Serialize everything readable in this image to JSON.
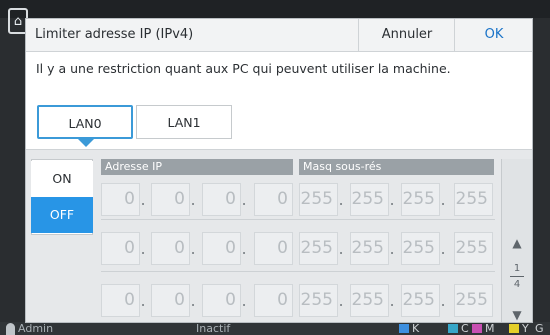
{
  "dialog": {
    "title": "Limiter adresse IP (IPv4)",
    "cancel_label": "Annuler",
    "ok_label": "OK",
    "message": "Il y a une restriction quant aux PC qui peuvent utiliser la machine."
  },
  "tabs": [
    {
      "label": "LAN0",
      "selected": true
    },
    {
      "label": "LAN1",
      "selected": false
    }
  ],
  "toggle": {
    "on_label": "ON",
    "off_label": "OFF",
    "selected": "OFF"
  },
  "columns": {
    "ip": "Adresse IP",
    "mask": "Masq sous-rés"
  },
  "rows": [
    {
      "ip": [
        "0",
        "0",
        "0",
        "0"
      ],
      "mask": [
        "255",
        "255",
        "255",
        "255"
      ]
    },
    {
      "ip": [
        "0",
        "0",
        "0",
        "0"
      ],
      "mask": [
        "255",
        "255",
        "255",
        "255"
      ]
    },
    {
      "ip": [
        "0",
        "0",
        "0",
        "0"
      ],
      "mask": [
        "255",
        "255",
        "255",
        "255"
      ]
    }
  ],
  "separator": ".",
  "pager": {
    "current": "1",
    "total": "4"
  },
  "statusbar": {
    "user": "Admin",
    "status": "Inactif",
    "inks": [
      "K",
      "C",
      "M",
      "Y",
      "G"
    ]
  },
  "colors": {
    "accent": "#2895e6",
    "selected_border": "#3b9ad8",
    "ok_text": "#1a73c8"
  },
  "icons": {
    "scroll_up": "triangle-up-icon",
    "scroll_down": "triangle-down-icon",
    "user": "user-icon"
  }
}
